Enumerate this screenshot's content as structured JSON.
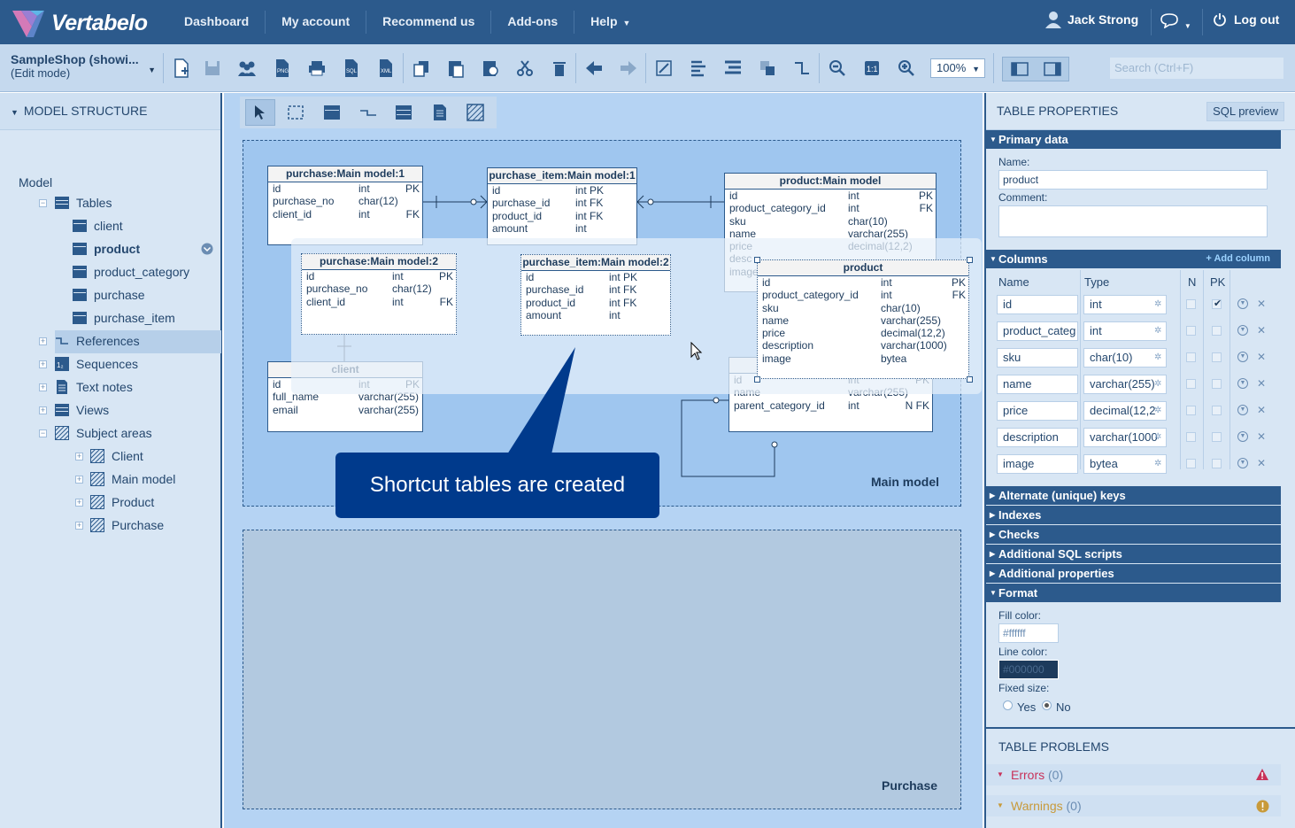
{
  "app": {
    "name": "Vertabelo"
  },
  "nav": {
    "items": [
      "Dashboard",
      "My account",
      "Recommend us",
      "Add-ons",
      "Help"
    ],
    "user": "Jack Strong",
    "logout": "Log out"
  },
  "toolbar": {
    "doc_title": "SampleShop (showi...",
    "doc_mode": "(Edit mode)",
    "zoom": "100%",
    "search_placeholder": "Search (Ctrl+F)"
  },
  "left": {
    "title": "MODEL STRUCTURE",
    "model": "Model",
    "tables_label": "Tables",
    "tables": [
      "client",
      "product",
      "product_category",
      "purchase",
      "purchase_item"
    ],
    "selected_table": "product",
    "groups": [
      "References",
      "Sequences",
      "Text notes",
      "Views",
      "Subject areas"
    ],
    "subject_areas": [
      "Client",
      "Main model",
      "Product",
      "Purchase"
    ]
  },
  "canvas": {
    "area_main": "Main model",
    "area_purchase": "Purchase",
    "callout": "Shortcut tables are created",
    "tables": {
      "purchase1": {
        "title": "purchase:Main model:1",
        "rows": [
          [
            "id",
            "int",
            "PK"
          ],
          [
            "purchase_no",
            "char(12)",
            ""
          ],
          [
            "client_id",
            "int",
            "FK"
          ]
        ]
      },
      "purchase_item1": {
        "title": "purchase_item:Main model:1",
        "rows": [
          [
            "id",
            "int PK",
            ""
          ],
          [
            "purchase_id",
            "int FK",
            ""
          ],
          [
            "product_id",
            "int FK",
            ""
          ],
          [
            "amount",
            "int",
            ""
          ]
        ]
      },
      "product_main": {
        "title": "product:Main model",
        "rows": [
          [
            "id",
            "int",
            "PK"
          ],
          [
            "product_category_id",
            "int",
            "FK"
          ],
          [
            "sku",
            "char(10)",
            ""
          ],
          [
            "name",
            "varchar(255)",
            ""
          ],
          [
            "price",
            "decimal(12,2)",
            ""
          ],
          [
            "desc",
            "",
            ""
          ],
          [
            "image",
            "",
            ""
          ]
        ]
      },
      "purchase2": {
        "title": "purchase:Main model:2",
        "rows": [
          [
            "id",
            "int",
            "PK"
          ],
          [
            "purchase_no",
            "char(12)",
            ""
          ],
          [
            "client_id",
            "int",
            "FK"
          ]
        ]
      },
      "purchase_item2": {
        "title": "purchase_item:Main model:2",
        "rows": [
          [
            "id",
            "int PK",
            ""
          ],
          [
            "purchase_id",
            "int FK",
            ""
          ],
          [
            "product_id",
            "int FK",
            ""
          ],
          [
            "amount",
            "int",
            ""
          ]
        ]
      },
      "product_new": {
        "title": "product",
        "rows": [
          [
            "id",
            "int",
            "PK"
          ],
          [
            "product_category_id",
            "int",
            "FK"
          ],
          [
            "sku",
            "char(10)",
            ""
          ],
          [
            "name",
            "varchar(255)",
            ""
          ],
          [
            "price",
            "decimal(12,2)",
            ""
          ],
          [
            "description",
            "varchar(1000)",
            ""
          ],
          [
            "image",
            "bytea",
            ""
          ]
        ]
      },
      "client": {
        "title": "client",
        "rows": [
          [
            "id",
            "int",
            "PK"
          ],
          [
            "full_name",
            "varchar(255)",
            ""
          ],
          [
            "email",
            "varchar(255)",
            ""
          ]
        ]
      },
      "product_category": {
        "title": "",
        "rows": [
          [
            "id",
            "int",
            "PK"
          ],
          [
            "name",
            "varchar(255)",
            ""
          ],
          [
            "parent_category_id",
            "int",
            "N FK"
          ]
        ]
      }
    }
  },
  "right": {
    "title": "TABLE PROPERTIES",
    "sql_preview": "SQL preview",
    "primary_data": "Primary data",
    "name_label": "Name:",
    "name_value": "product",
    "comment_label": "Comment:",
    "columns_label": "Columns",
    "add_column": "+ Add column",
    "col_headers": [
      "Name",
      "Type",
      "N",
      "PK"
    ],
    "columns": [
      {
        "name": "id",
        "type": "int",
        "pk": true
      },
      {
        "name": "product_categ",
        "type": "int",
        "pk": false
      },
      {
        "name": "sku",
        "type": "char(10)",
        "pk": false
      },
      {
        "name": "name",
        "type": "varchar(255)",
        "pk": false
      },
      {
        "name": "price",
        "type": "decimal(12,2",
        "pk": false
      },
      {
        "name": "description",
        "type": "varchar(1000",
        "pk": false
      },
      {
        "name": "image",
        "type": "bytea",
        "pk": false
      }
    ],
    "sections": [
      "Alternate (unique) keys",
      "Indexes",
      "Checks",
      "Additional SQL scripts",
      "Additional properties",
      "Format"
    ],
    "fill_label": "Fill color:",
    "fill_value": "#ffffff",
    "line_label": "Line color:",
    "line_value": "#000000",
    "fixed_label": "Fixed size:",
    "yes": "Yes",
    "no": "No",
    "problems_title": "TABLE PROBLEMS",
    "errors": "Errors",
    "errors_count": "(0)",
    "warnings": "Warnings",
    "warnings_count": "(0)",
    "colors": {
      "error": "#c8325a",
      "warning": "#c89a3a"
    }
  }
}
